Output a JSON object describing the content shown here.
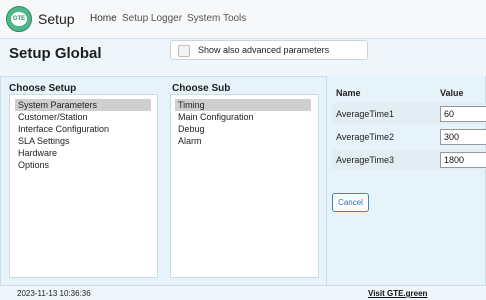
{
  "app": {
    "logo_text": "GTE",
    "title": "Setup"
  },
  "nav": {
    "home": "Home",
    "setup_logger": "Setup Logger",
    "system_tools": "System Tools"
  },
  "global": {
    "title": "Setup Global",
    "show_advanced_label": "Show also advanced parameters",
    "show_advanced_checked": false
  },
  "setup": {
    "title": "Choose Setup",
    "items": [
      "System Parameters",
      "Customer/Station",
      "Interface Configuration",
      "SLA Settings",
      "Hardware",
      "Options"
    ],
    "selected": "System Parameters"
  },
  "sub": {
    "title": "Choose Sub",
    "items": [
      "Timing",
      "Main Configuration",
      "Debug",
      "Alarm"
    ],
    "selected": "Timing"
  },
  "params": {
    "headers": {
      "name": "Name",
      "value": "Value"
    },
    "rows": [
      {
        "name": "AverageTime1",
        "value": "60"
      },
      {
        "name": "AverageTime2",
        "value": "300"
      },
      {
        "name": "AverageTime3",
        "value": "1800"
      }
    ],
    "cancel_label": "Cancel"
  },
  "footer": {
    "timestamp": "2023-11-13 10:36:36",
    "link": "Visit GTE.green"
  },
  "colors": {
    "background": "#eef6fb",
    "logo": "#4fb88a",
    "accent": "#3b86c6",
    "selected_item": "#cfcfcf"
  }
}
